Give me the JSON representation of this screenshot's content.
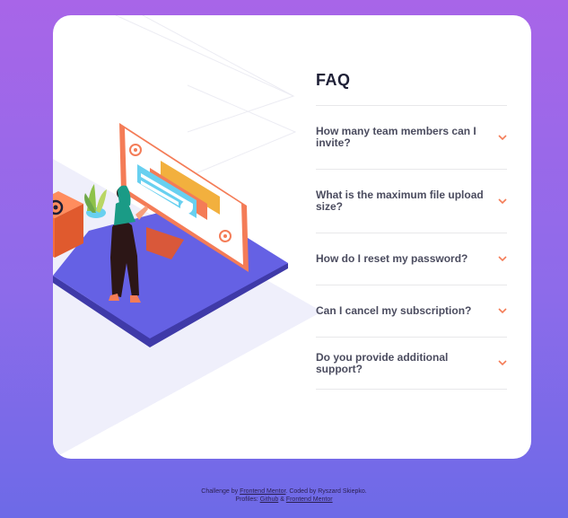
{
  "faq": {
    "title": "FAQ",
    "items": [
      {
        "question": "How many team members can I invite?"
      },
      {
        "question": "What is the maximum file upload size?"
      },
      {
        "question": "How do I reset my password?"
      },
      {
        "question": "Can I cancel my subscription?"
      },
      {
        "question": "Do you provide additional support?"
      }
    ]
  },
  "footer": {
    "challenge_prefix": "Challenge by ",
    "challenge_link": "Frontend Mentor",
    "coded_by": ". Coded by Ryszard Skiepko.",
    "profiles_prefix": "Profiles: ",
    "github_link": "Github",
    "ampersand": " & ",
    "fm_link": "Frontend Mentor"
  },
  "colors": {
    "accent": "#f47c57",
    "heading": "#1e1f36",
    "question": "#4b4c5f",
    "platform": "#5a57d6"
  },
  "icons": {
    "chevron": "chevron-down-icon",
    "at_box": "at-sign-box-icon",
    "at_screen": "at-sign-icon"
  }
}
